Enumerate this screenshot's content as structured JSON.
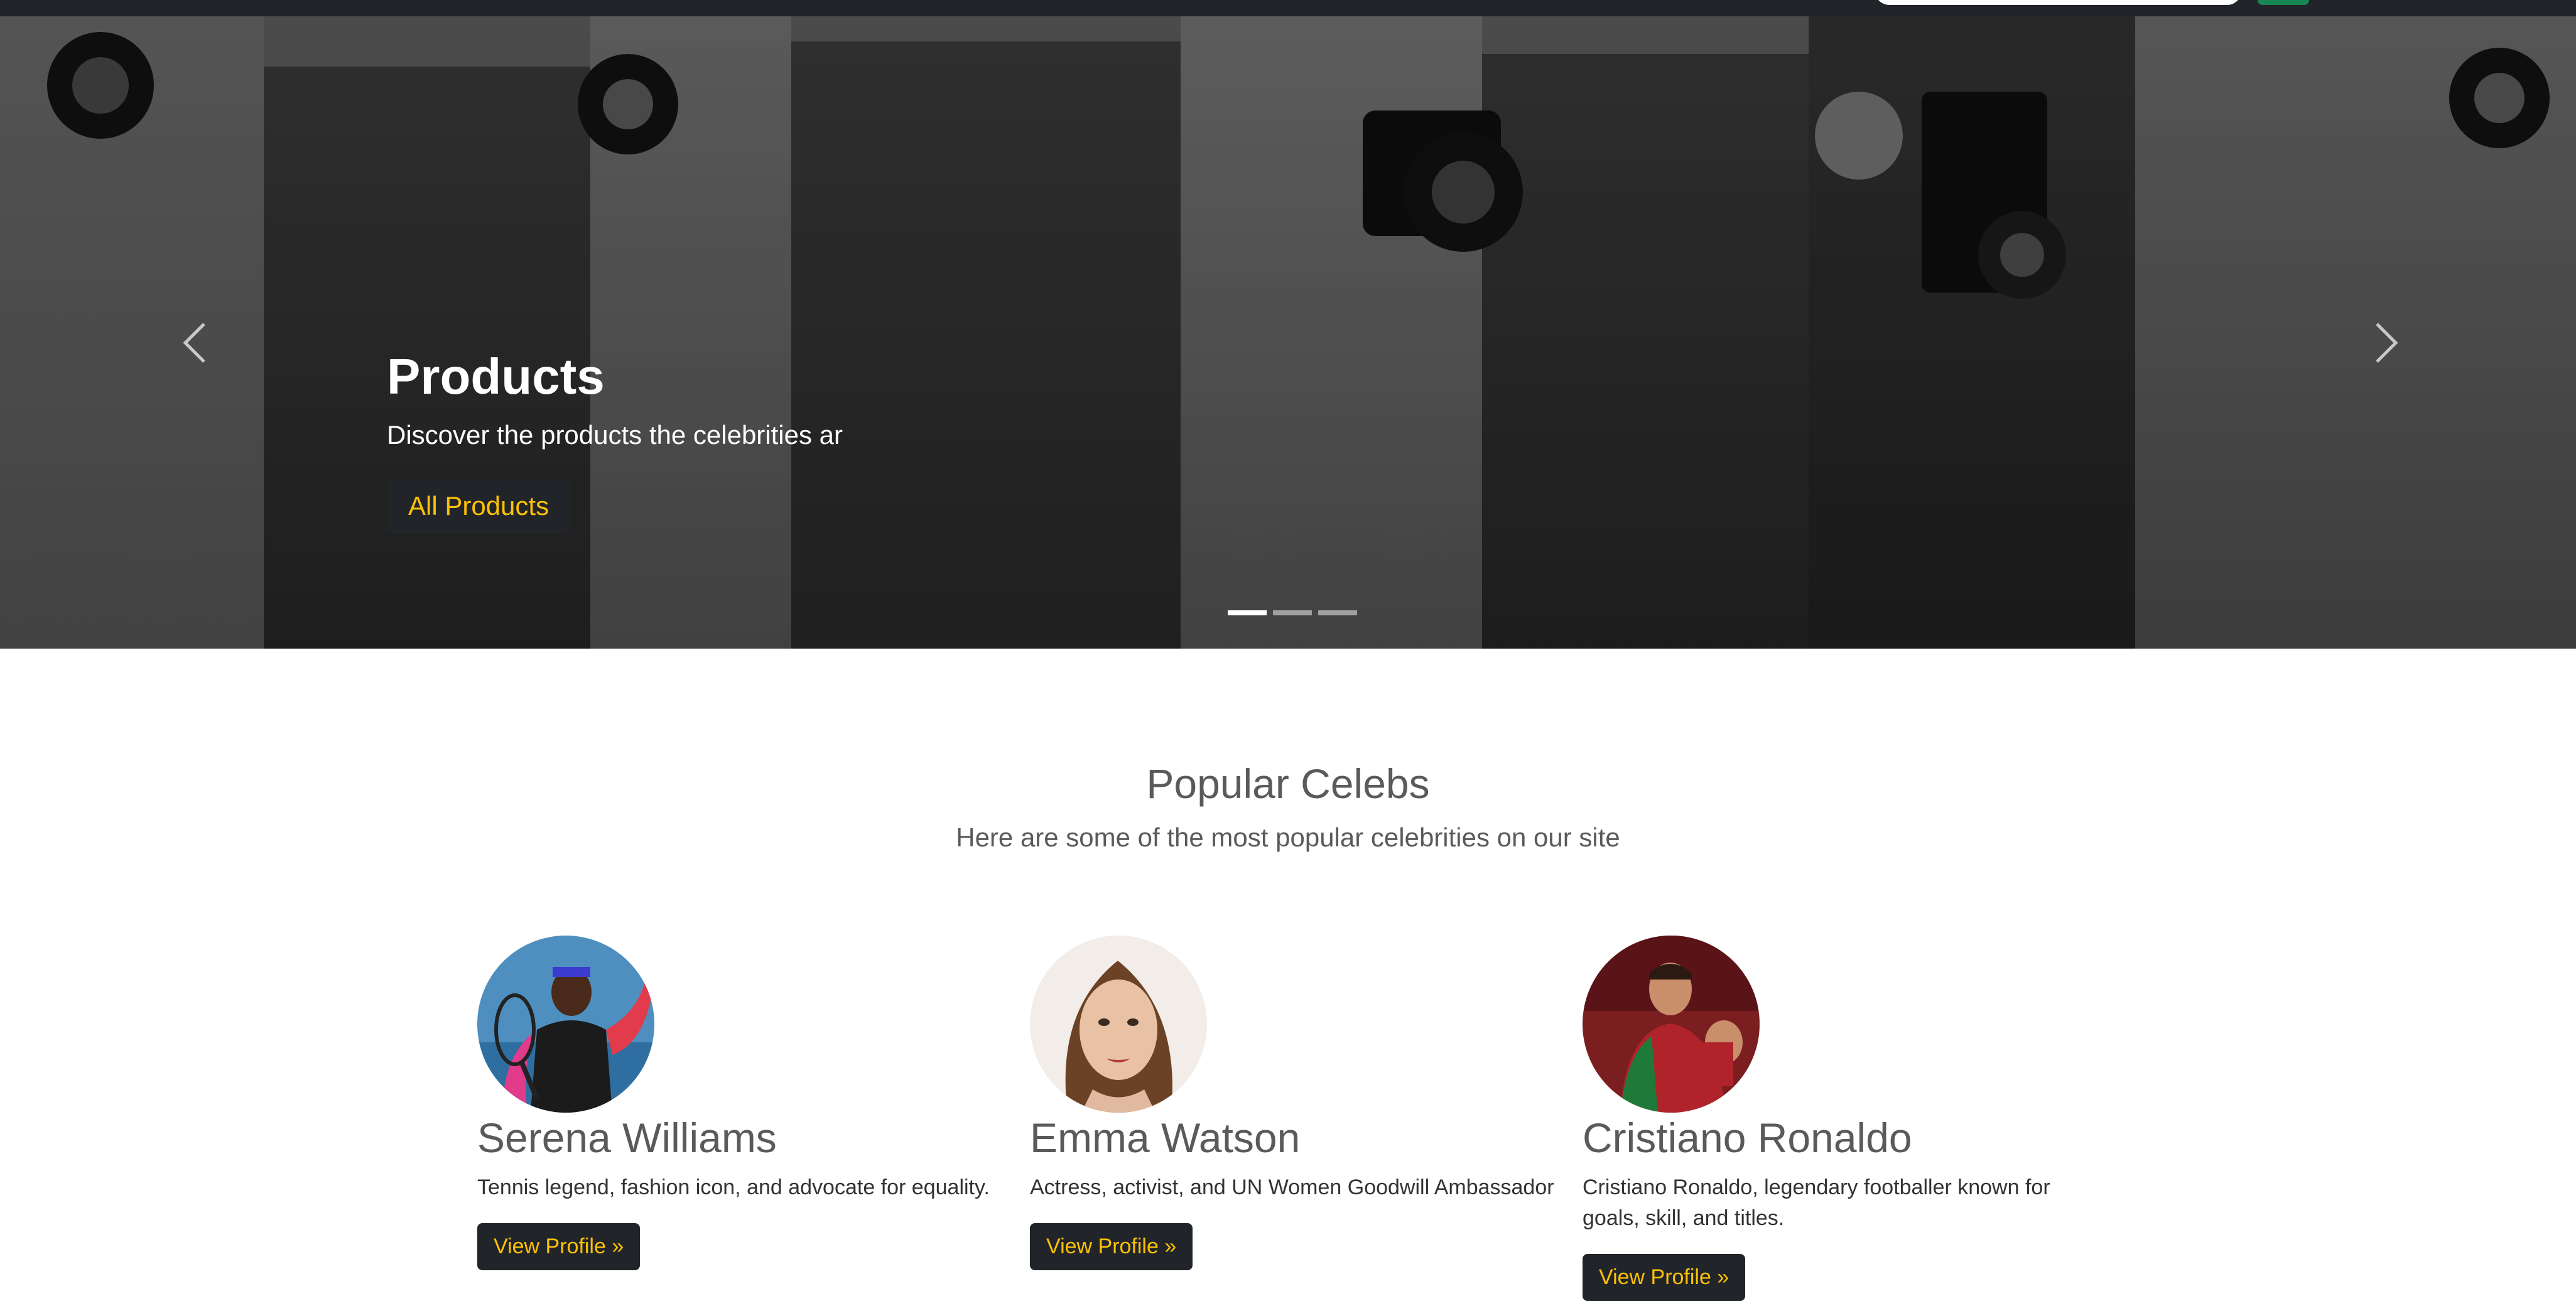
{
  "carousel": {
    "title": "Products",
    "subtitle": "Discover the products the celebrities ar",
    "cta_label": "All Products",
    "slide_count": 3,
    "active_slide": 1
  },
  "popular": {
    "title": "Popular Celebs",
    "subtitle": "Here are some of the most popular celebrities on our site"
  },
  "celebs": [
    {
      "name": "Serena Williams",
      "description": "Tennis legend, fashion icon, and advocate for equality.",
      "button": "View Profile »"
    },
    {
      "name": "Emma Watson",
      "description": "Actress, activist, and UN Women Goodwill Ambassador",
      "button": "View Profile »"
    },
    {
      "name": "Cristiano Ronaldo",
      "description": "Cristiano Ronaldo, legendary footballer known for goals, skill, and titles.",
      "button": "View Profile »"
    }
  ],
  "colors": {
    "navbar": "#212529",
    "accent": "#ffc107",
    "search_button": "#198754",
    "heading_text": "#5a5a5a"
  },
  "icons": {
    "prev": "chevron-left-icon",
    "next": "chevron-right-icon"
  }
}
